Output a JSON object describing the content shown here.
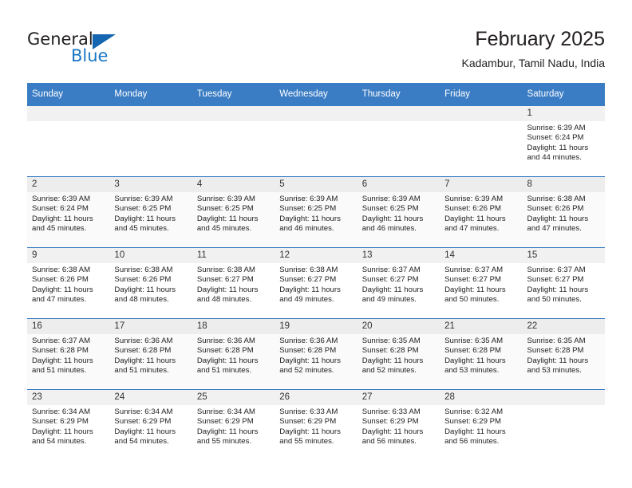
{
  "brand": {
    "name_part1": "General",
    "name_part2": "Blue",
    "triangle_color": "#1565b0",
    "blue_color": "#1b76c4"
  },
  "header": {
    "title": "February 2025",
    "subtitle": "Kadambur, Tamil Nadu, India"
  },
  "theme": {
    "header_row_bg": "#3b7dc4",
    "header_row_text": "#ffffff",
    "daynum_bg": "#f1f1f1",
    "row_border": "#3b7dc4",
    "alt_row_bg": "#fafafa"
  },
  "weekdays": [
    "Sunday",
    "Monday",
    "Tuesday",
    "Wednesday",
    "Thursday",
    "Friday",
    "Saturday"
  ],
  "weeks": [
    [
      {
        "day": "",
        "sunrise": "",
        "sunset": "",
        "daylight_line1": "",
        "daylight_line2": ""
      },
      {
        "day": "",
        "sunrise": "",
        "sunset": "",
        "daylight_line1": "",
        "daylight_line2": ""
      },
      {
        "day": "",
        "sunrise": "",
        "sunset": "",
        "daylight_line1": "",
        "daylight_line2": ""
      },
      {
        "day": "",
        "sunrise": "",
        "sunset": "",
        "daylight_line1": "",
        "daylight_line2": ""
      },
      {
        "day": "",
        "sunrise": "",
        "sunset": "",
        "daylight_line1": "",
        "daylight_line2": ""
      },
      {
        "day": "",
        "sunrise": "",
        "sunset": "",
        "daylight_line1": "",
        "daylight_line2": ""
      },
      {
        "day": "1",
        "sunrise": "Sunrise: 6:39 AM",
        "sunset": "Sunset: 6:24 PM",
        "daylight_line1": "Daylight: 11 hours",
        "daylight_line2": "and 44 minutes."
      }
    ],
    [
      {
        "day": "2",
        "sunrise": "Sunrise: 6:39 AM",
        "sunset": "Sunset: 6:24 PM",
        "daylight_line1": "Daylight: 11 hours",
        "daylight_line2": "and 45 minutes."
      },
      {
        "day": "3",
        "sunrise": "Sunrise: 6:39 AM",
        "sunset": "Sunset: 6:25 PM",
        "daylight_line1": "Daylight: 11 hours",
        "daylight_line2": "and 45 minutes."
      },
      {
        "day": "4",
        "sunrise": "Sunrise: 6:39 AM",
        "sunset": "Sunset: 6:25 PM",
        "daylight_line1": "Daylight: 11 hours",
        "daylight_line2": "and 45 minutes."
      },
      {
        "day": "5",
        "sunrise": "Sunrise: 6:39 AM",
        "sunset": "Sunset: 6:25 PM",
        "daylight_line1": "Daylight: 11 hours",
        "daylight_line2": "and 46 minutes."
      },
      {
        "day": "6",
        "sunrise": "Sunrise: 6:39 AM",
        "sunset": "Sunset: 6:25 PM",
        "daylight_line1": "Daylight: 11 hours",
        "daylight_line2": "and 46 minutes."
      },
      {
        "day": "7",
        "sunrise": "Sunrise: 6:39 AM",
        "sunset": "Sunset: 6:26 PM",
        "daylight_line1": "Daylight: 11 hours",
        "daylight_line2": "and 47 minutes."
      },
      {
        "day": "8",
        "sunrise": "Sunrise: 6:38 AM",
        "sunset": "Sunset: 6:26 PM",
        "daylight_line1": "Daylight: 11 hours",
        "daylight_line2": "and 47 minutes."
      }
    ],
    [
      {
        "day": "9",
        "sunrise": "Sunrise: 6:38 AM",
        "sunset": "Sunset: 6:26 PM",
        "daylight_line1": "Daylight: 11 hours",
        "daylight_line2": "and 47 minutes."
      },
      {
        "day": "10",
        "sunrise": "Sunrise: 6:38 AM",
        "sunset": "Sunset: 6:26 PM",
        "daylight_line1": "Daylight: 11 hours",
        "daylight_line2": "and 48 minutes."
      },
      {
        "day": "11",
        "sunrise": "Sunrise: 6:38 AM",
        "sunset": "Sunset: 6:27 PM",
        "daylight_line1": "Daylight: 11 hours",
        "daylight_line2": "and 48 minutes."
      },
      {
        "day": "12",
        "sunrise": "Sunrise: 6:38 AM",
        "sunset": "Sunset: 6:27 PM",
        "daylight_line1": "Daylight: 11 hours",
        "daylight_line2": "and 49 minutes."
      },
      {
        "day": "13",
        "sunrise": "Sunrise: 6:37 AM",
        "sunset": "Sunset: 6:27 PM",
        "daylight_line1": "Daylight: 11 hours",
        "daylight_line2": "and 49 minutes."
      },
      {
        "day": "14",
        "sunrise": "Sunrise: 6:37 AM",
        "sunset": "Sunset: 6:27 PM",
        "daylight_line1": "Daylight: 11 hours",
        "daylight_line2": "and 50 minutes."
      },
      {
        "day": "15",
        "sunrise": "Sunrise: 6:37 AM",
        "sunset": "Sunset: 6:27 PM",
        "daylight_line1": "Daylight: 11 hours",
        "daylight_line2": "and 50 minutes."
      }
    ],
    [
      {
        "day": "16",
        "sunrise": "Sunrise: 6:37 AM",
        "sunset": "Sunset: 6:28 PM",
        "daylight_line1": "Daylight: 11 hours",
        "daylight_line2": "and 51 minutes."
      },
      {
        "day": "17",
        "sunrise": "Sunrise: 6:36 AM",
        "sunset": "Sunset: 6:28 PM",
        "daylight_line1": "Daylight: 11 hours",
        "daylight_line2": "and 51 minutes."
      },
      {
        "day": "18",
        "sunrise": "Sunrise: 6:36 AM",
        "sunset": "Sunset: 6:28 PM",
        "daylight_line1": "Daylight: 11 hours",
        "daylight_line2": "and 51 minutes."
      },
      {
        "day": "19",
        "sunrise": "Sunrise: 6:36 AM",
        "sunset": "Sunset: 6:28 PM",
        "daylight_line1": "Daylight: 11 hours",
        "daylight_line2": "and 52 minutes."
      },
      {
        "day": "20",
        "sunrise": "Sunrise: 6:35 AM",
        "sunset": "Sunset: 6:28 PM",
        "daylight_line1": "Daylight: 11 hours",
        "daylight_line2": "and 52 minutes."
      },
      {
        "day": "21",
        "sunrise": "Sunrise: 6:35 AM",
        "sunset": "Sunset: 6:28 PM",
        "daylight_line1": "Daylight: 11 hours",
        "daylight_line2": "and 53 minutes."
      },
      {
        "day": "22",
        "sunrise": "Sunrise: 6:35 AM",
        "sunset": "Sunset: 6:28 PM",
        "daylight_line1": "Daylight: 11 hours",
        "daylight_line2": "and 53 minutes."
      }
    ],
    [
      {
        "day": "23",
        "sunrise": "Sunrise: 6:34 AM",
        "sunset": "Sunset: 6:29 PM",
        "daylight_line1": "Daylight: 11 hours",
        "daylight_line2": "and 54 minutes."
      },
      {
        "day": "24",
        "sunrise": "Sunrise: 6:34 AM",
        "sunset": "Sunset: 6:29 PM",
        "daylight_line1": "Daylight: 11 hours",
        "daylight_line2": "and 54 minutes."
      },
      {
        "day": "25",
        "sunrise": "Sunrise: 6:34 AM",
        "sunset": "Sunset: 6:29 PM",
        "daylight_line1": "Daylight: 11 hours",
        "daylight_line2": "and 55 minutes."
      },
      {
        "day": "26",
        "sunrise": "Sunrise: 6:33 AM",
        "sunset": "Sunset: 6:29 PM",
        "daylight_line1": "Daylight: 11 hours",
        "daylight_line2": "and 55 minutes."
      },
      {
        "day": "27",
        "sunrise": "Sunrise: 6:33 AM",
        "sunset": "Sunset: 6:29 PM",
        "daylight_line1": "Daylight: 11 hours",
        "daylight_line2": "and 56 minutes."
      },
      {
        "day": "28",
        "sunrise": "Sunrise: 6:32 AM",
        "sunset": "Sunset: 6:29 PM",
        "daylight_line1": "Daylight: 11 hours",
        "daylight_line2": "and 56 minutes."
      },
      {
        "day": "",
        "sunrise": "",
        "sunset": "",
        "daylight_line1": "",
        "daylight_line2": ""
      }
    ]
  ]
}
